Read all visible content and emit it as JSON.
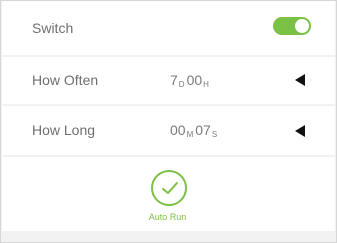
{
  "switch_row": {
    "label": "Switch",
    "enabled": true,
    "accent": "#7bc143"
  },
  "how_often": {
    "label": "How Often",
    "d_value": "7",
    "d_unit": "D",
    "h_value": "00",
    "h_unit": "H",
    "arrow_icon": "left-triangle-icon"
  },
  "how_long": {
    "label": "How Long",
    "m_value": "00",
    "m_unit": "M",
    "s_value": "07",
    "s_unit": "S",
    "arrow_icon": "left-triangle-icon"
  },
  "auto_run": {
    "label": "Auto Run",
    "icon": "checkmark-circle-icon"
  }
}
